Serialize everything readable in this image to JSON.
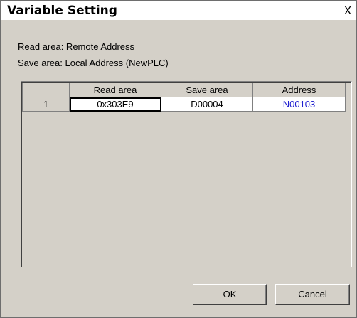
{
  "dialog": {
    "title": "Variable Setting",
    "close_glyph": "X",
    "read_area_line": "Read area: Remote Address",
    "save_area_line": "Save area: Local Address (NewPLC)"
  },
  "table": {
    "columns": [
      "Read area",
      "Save area",
      "Address"
    ],
    "rows": [
      {
        "index": "1",
        "read_area": "0x303E9",
        "save_area": "D00004",
        "address": "N00103"
      }
    ]
  },
  "buttons": {
    "ok": "OK",
    "cancel": "Cancel"
  },
  "colors": {
    "dialog_bg": "#d4d0c8",
    "address_text": "#2020d0"
  }
}
